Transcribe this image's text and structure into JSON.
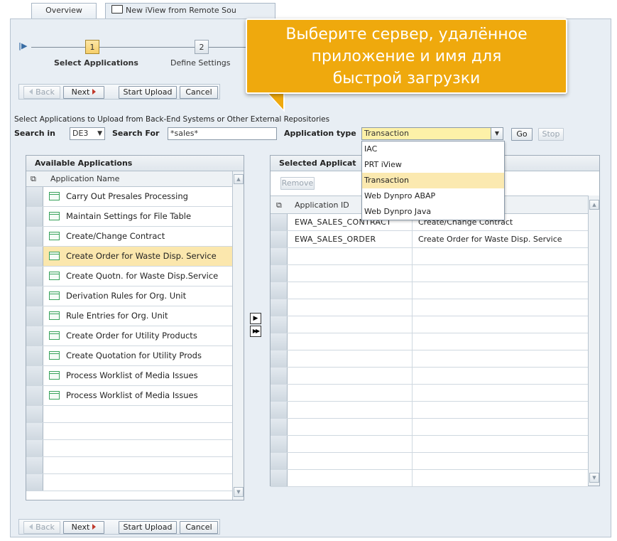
{
  "tabs": {
    "overview": "Overview",
    "new_view": "New iView from Remote Sou"
  },
  "roadmap": {
    "step1_num": "1",
    "step1_label": "Select Applications",
    "step2_num": "2",
    "step2_label": "Define Settings"
  },
  "toolbar": {
    "back": "Back",
    "next": "Next",
    "start_upload": "Start Upload",
    "cancel": "Cancel"
  },
  "callout": {
    "line1": "Выберите сервер, удалённое",
    "line2": "приложение и имя для",
    "line3": "быстрой загрузки"
  },
  "search": {
    "instruction": "Select Applications to Upload from Back-End Systems or Other External Repositories",
    "search_in_label": "Search in",
    "search_in_value": "DE3",
    "search_for_label": "Search For",
    "search_for_value": "*sales*",
    "app_type_label": "Application type",
    "app_type_value": "Transaction",
    "go": "Go",
    "stop": "Stop"
  },
  "app_type_options": [
    "IAC",
    "PRT iView",
    "Transaction",
    "Web Dynpro ABAP",
    "Web Dynpro Java"
  ],
  "available": {
    "title": "Available Applications",
    "column": "Application Name",
    "items": [
      "Carry Out Presales Processing",
      "Maintain Settings for File Table",
      "Create/Change Contract",
      "Create Order for Waste Disp. Service",
      "Create Quotn. for Waste Disp.Service",
      "Derivation Rules for Org. Unit",
      "Rule Entries for Org. Unit",
      "Create Order for Utility Products",
      "Create Quotation for Utility Prods",
      "Process Worklist of Media Issues",
      "Process Worklist of Media Issues"
    ],
    "highlighted_index": 3
  },
  "selected": {
    "title": "Selected Applicat",
    "remove": "Remove",
    "col_id": "Application ID",
    "rows": [
      {
        "id": "EWA_SALES_CONTRACT",
        "name": "Create/Change Contract"
      },
      {
        "id": "EWA_SALES_ORDER",
        "name": "Create Order for Waste Disp. Service"
      }
    ]
  },
  "move_buttons": {
    "one": "▶",
    "all": "▶▶"
  },
  "colors": {
    "accent": "#efa90d",
    "highlight": "#fbe7ad",
    "frame": "#e8eef4"
  }
}
